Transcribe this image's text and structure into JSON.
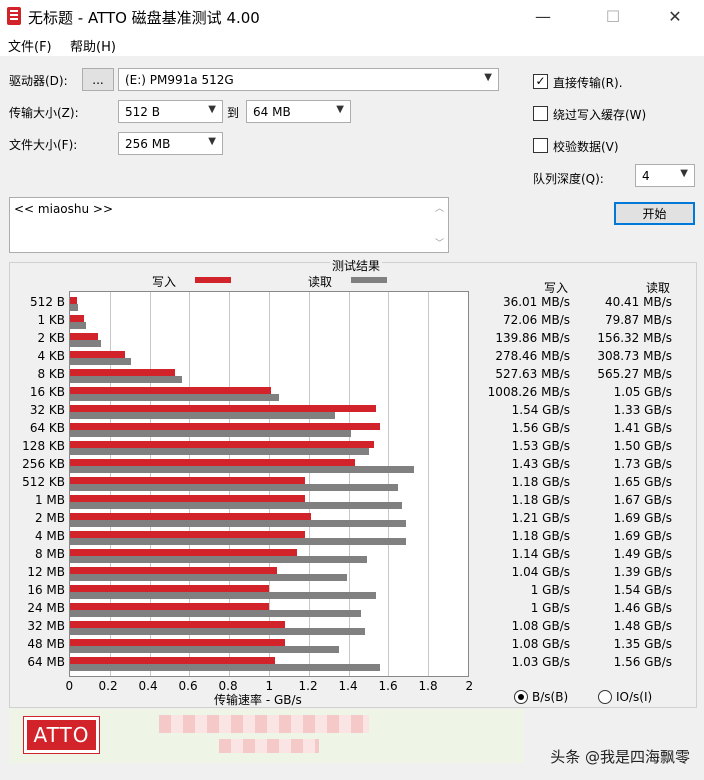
{
  "window": {
    "title": "无标题 - ATTO 磁盘基准测试 4.00",
    "minimize": "—",
    "maximize": "☐",
    "close": "✕"
  },
  "menu": {
    "file": "文件(F)",
    "help": "帮助(H)"
  },
  "form": {
    "drive_label": "驱动器(D):",
    "drive_browse": "...",
    "drive_value": "(E:) PM991a 512G",
    "transfer_label": "传输大小(Z):",
    "transfer_from": "512 B",
    "to_label": "到",
    "transfer_to": "64 MB",
    "filesize_label": "文件大小(F):",
    "filesize_value": "256 MB",
    "direct_io": "直接传输(R).",
    "direct_io_checked": true,
    "bypass_cache": "绕过写入缓存(W)",
    "verify": "校验数据(V)",
    "queue_label": "队列深度(Q):",
    "queue_value": "4",
    "start": "开始",
    "description": "<< miaoshu >>"
  },
  "results": {
    "title": "测试结果",
    "legend_write": "写入",
    "legend_read": "读取",
    "col_write": "写入",
    "col_read": "读取",
    "xlabel": "传输速率 - GB/s",
    "unit_bytes": "B/s(B)",
    "unit_io": "IO/s(I)"
  },
  "chart_data": {
    "type": "bar",
    "orientation": "horizontal",
    "title": "测试结果",
    "xlabel": "传输速率 - GB/s",
    "xlim": [
      0,
      2
    ],
    "xticks": [
      "0",
      "0.2",
      "0.4",
      "0.6",
      "0.8",
      "1",
      "1.2",
      "1.4",
      "1.6",
      "1.8",
      "2"
    ],
    "categories": [
      "512 B",
      "1 KB",
      "2 KB",
      "4 KB",
      "8 KB",
      "16 KB",
      "32 KB",
      "64 KB",
      "128 KB",
      "256 KB",
      "512 KB",
      "1 MB",
      "2 MB",
      "4 MB",
      "8 MB",
      "12 MB",
      "16 MB",
      "24 MB",
      "32 MB",
      "48 MB",
      "64 MB"
    ],
    "series": [
      {
        "name": "写入",
        "color": "#d2232a",
        "values": [
          0.036,
          0.072,
          0.14,
          0.278,
          0.528,
          1.008,
          1.54,
          1.56,
          1.53,
          1.43,
          1.18,
          1.18,
          1.21,
          1.18,
          1.14,
          1.04,
          1.0,
          1.0,
          1.08,
          1.08,
          1.03
        ],
        "labels": [
          "36.01 MB/s",
          "72.06 MB/s",
          "139.86 MB/s",
          "278.46 MB/s",
          "527.63 MB/s",
          "1008.26 MB/s",
          "1.54 GB/s",
          "1.56 GB/s",
          "1.53 GB/s",
          "1.43 GB/s",
          "1.18 GB/s",
          "1.18 GB/s",
          "1.21 GB/s",
          "1.18 GB/s",
          "1.14 GB/s",
          "1.04 GB/s",
          "1 GB/s",
          "1 GB/s",
          "1.08 GB/s",
          "1.08 GB/s",
          "1.03 GB/s"
        ]
      },
      {
        "name": "读取",
        "color": "#808080",
        "values": [
          0.04,
          0.08,
          0.156,
          0.309,
          0.565,
          1.05,
          1.33,
          1.41,
          1.5,
          1.73,
          1.65,
          1.67,
          1.69,
          1.69,
          1.49,
          1.39,
          1.54,
          1.46,
          1.48,
          1.35,
          1.56
        ],
        "labels": [
          "40.41 MB/s",
          "79.87 MB/s",
          "156.32 MB/s",
          "308.73 MB/s",
          "565.27 MB/s",
          "1.05 GB/s",
          "1.33 GB/s",
          "1.41 GB/s",
          "1.50 GB/s",
          "1.73 GB/s",
          "1.65 GB/s",
          "1.67 GB/s",
          "1.69 GB/s",
          "1.69 GB/s",
          "1.49 GB/s",
          "1.39 GB/s",
          "1.54 GB/s",
          "1.46 GB/s",
          "1.48 GB/s",
          "1.35 GB/s",
          "1.56 GB/s"
        ]
      }
    ]
  },
  "banner": {
    "logo": "ATTO"
  },
  "watermark": "头条 @我是四海飘零"
}
